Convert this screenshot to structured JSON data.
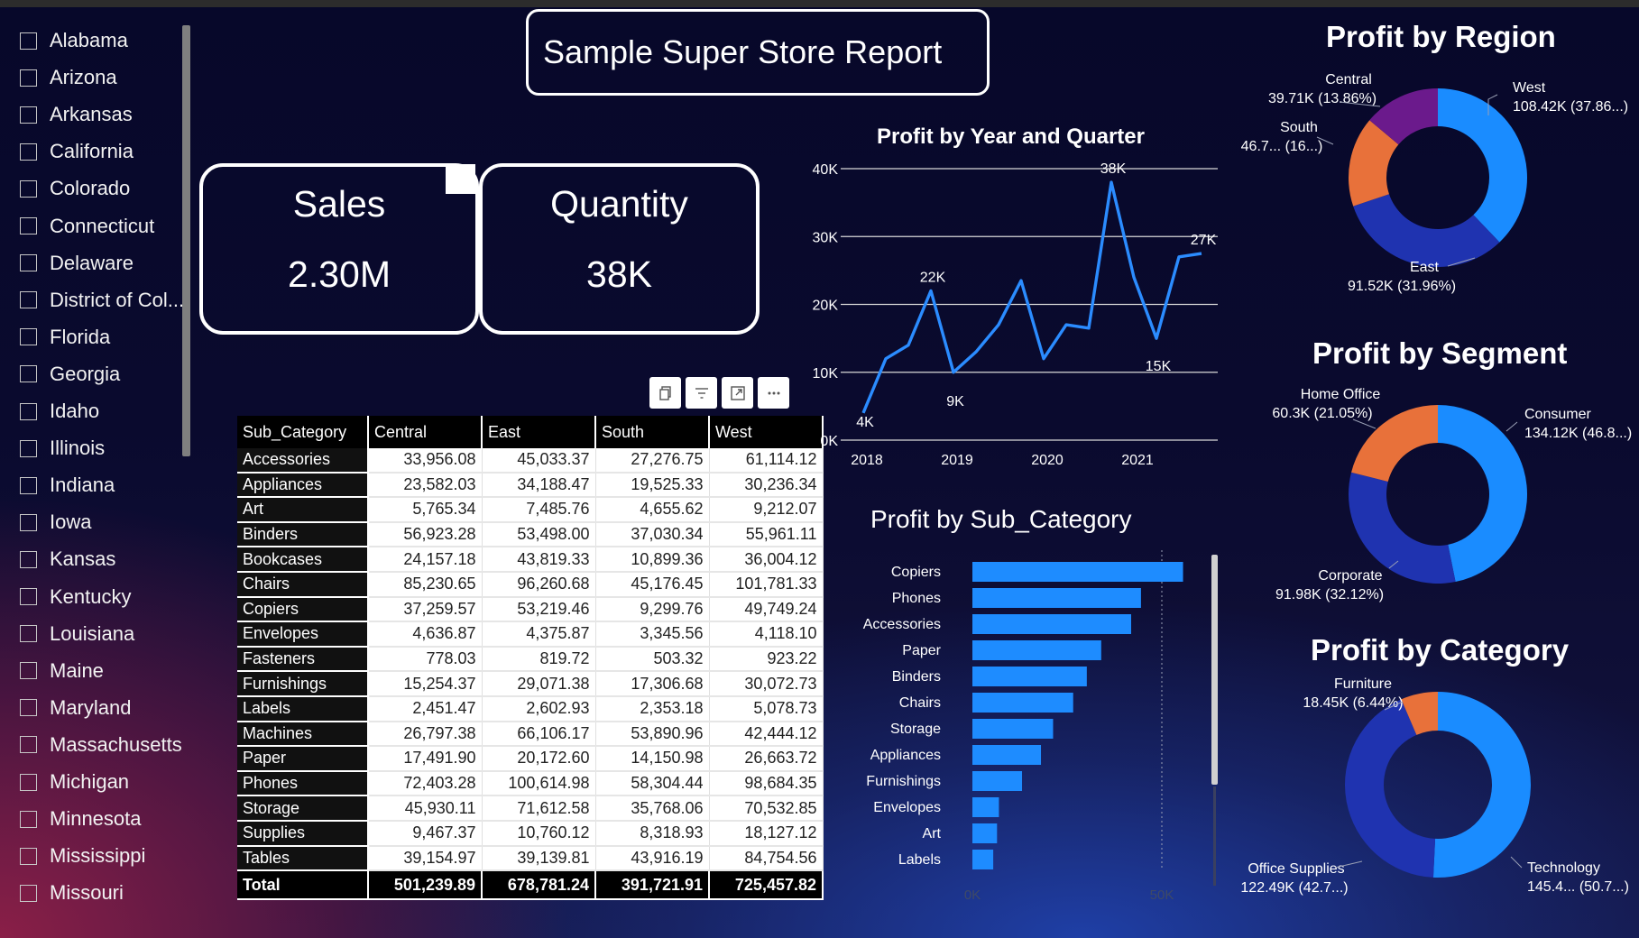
{
  "report_title": "Sample Super Store Report",
  "slicer": {
    "items": [
      "Alabama",
      "Arizona",
      "Arkansas",
      "California",
      "Colorado",
      "Connecticut",
      "Delaware",
      "District of Col...",
      "Florida",
      "Georgia",
      "Idaho",
      "Illinois",
      "Indiana",
      "Iowa",
      "Kansas",
      "Kentucky",
      "Louisiana",
      "Maine",
      "Maryland",
      "Massachusetts",
      "Michigan",
      "Minnesota",
      "Mississippi",
      "Missouri"
    ]
  },
  "cards": {
    "sales": {
      "label": "Sales",
      "value": "2.30M"
    },
    "quantity": {
      "label": "Quantity",
      "value": "38K"
    }
  },
  "visual_header": {
    "icons": [
      "copy-icon",
      "filter-icon",
      "focus-mode-icon",
      "more-options-icon"
    ]
  },
  "table": {
    "headers": [
      "Sub_Category",
      "Central",
      "East",
      "South",
      "West"
    ],
    "rows": [
      [
        "Accessories",
        "33,956.08",
        "45,033.37",
        "27,276.75",
        "61,114.12"
      ],
      [
        "Appliances",
        "23,582.03",
        "34,188.47",
        "19,525.33",
        "30,236.34"
      ],
      [
        "Art",
        "5,765.34",
        "7,485.76",
        "4,655.62",
        "9,212.07"
      ],
      [
        "Binders",
        "56,923.28",
        "53,498.00",
        "37,030.34",
        "55,961.11"
      ],
      [
        "Bookcases",
        "24,157.18",
        "43,819.33",
        "10,899.36",
        "36,004.12"
      ],
      [
        "Chairs",
        "85,230.65",
        "96,260.68",
        "45,176.45",
        "101,781.33"
      ],
      [
        "Copiers",
        "37,259.57",
        "53,219.46",
        "9,299.76",
        "49,749.24"
      ],
      [
        "Envelopes",
        "4,636.87",
        "4,375.87",
        "3,345.56",
        "4,118.10"
      ],
      [
        "Fasteners",
        "778.03",
        "819.72",
        "503.32",
        "923.22"
      ],
      [
        "Furnishings",
        "15,254.37",
        "29,071.38",
        "17,306.68",
        "30,072.73"
      ],
      [
        "Labels",
        "2,451.47",
        "2,602.93",
        "2,353.18",
        "5,078.73"
      ],
      [
        "Machines",
        "26,797.38",
        "66,106.17",
        "53,890.96",
        "42,444.12"
      ],
      [
        "Paper",
        "17,491.90",
        "20,172.60",
        "14,150.98",
        "26,663.72"
      ],
      [
        "Phones",
        "72,403.28",
        "100,614.98",
        "58,304.44",
        "98,684.35"
      ],
      [
        "Storage",
        "45,930.11",
        "71,612.58",
        "35,768.06",
        "70,532.85"
      ],
      [
        "Supplies",
        "9,467.37",
        "10,760.12",
        "8,318.93",
        "18,127.12"
      ],
      [
        "Tables",
        "39,154.97",
        "39,139.81",
        "43,916.19",
        "84,754.56"
      ]
    ],
    "total": [
      "Total",
      "501,239.89",
      "678,781.24",
      "391,721.91",
      "725,457.82"
    ]
  },
  "chart_data": [
    {
      "id": "year_quarter",
      "type": "line",
      "title": "Profit by Year and Quarter",
      "x_ticks": [
        "2018",
        "2019",
        "2020",
        "2021"
      ],
      "y_ticks": [
        "0K",
        "10K",
        "20K",
        "30K",
        "40K"
      ],
      "ylim": [
        0,
        40
      ],
      "values": [
        4,
        12,
        14,
        22,
        10,
        13,
        17,
        23.5,
        12,
        17,
        16.5,
        38,
        24,
        15,
        27,
        27.5
      ],
      "data_labels": [
        {
          "i": 0,
          "text": "4K"
        },
        {
          "i": 3,
          "text": "22K"
        },
        {
          "i": 4,
          "text": "9K"
        },
        {
          "i": 11,
          "text": "38K"
        },
        {
          "i": 13,
          "text": "15K"
        },
        {
          "i": 15,
          "text": "27K"
        }
      ],
      "color": "#2b8cff"
    },
    {
      "id": "sub_category",
      "type": "bar",
      "orientation": "horizontal",
      "title": "Profit by Sub_Category",
      "categories": [
        "Copiers",
        "Phones",
        "Accessories",
        "Paper",
        "Binders",
        "Chairs",
        "Storage",
        "Appliances",
        "Furnishings",
        "Envelopes",
        "Art",
        "Labels"
      ],
      "values": [
        55.6,
        44.5,
        41.9,
        34.0,
        30.2,
        26.6,
        21.3,
        18.1,
        13.1,
        7.0,
        6.5,
        5.5
      ],
      "x_ticks": [
        "0K",
        "50K"
      ],
      "xlim": [
        0,
        50
      ],
      "color": "#1e8cff"
    },
    {
      "id": "region",
      "type": "pie",
      "donut": true,
      "title": "Profit by Region",
      "slices": [
        {
          "name": "West",
          "value": 108.42,
          "label": "108.42K (37.86...)",
          "color": "#1a8cff"
        },
        {
          "name": "East",
          "value": 91.52,
          "label": "91.52K (31.96%)",
          "color": "#1f33b0"
        },
        {
          "name": "South",
          "value": 46.7,
          "label": "46.7... (16...)",
          "color": "#e8713a"
        },
        {
          "name": "Central",
          "value": 39.71,
          "label": "39.71K (13.86%)",
          "color": "#6b1a8c"
        }
      ]
    },
    {
      "id": "segment",
      "type": "pie",
      "donut": true,
      "title": "Profit by Segment",
      "slices": [
        {
          "name": "Consumer",
          "value": 134.12,
          "label": "134.12K (46.8...)",
          "color": "#1a8cff"
        },
        {
          "name": "Corporate",
          "value": 91.98,
          "label": "91.98K (32.12%)",
          "color": "#1f33b0"
        },
        {
          "name": "Home Office",
          "value": 60.3,
          "label": "60.3K (21.05%)",
          "color": "#e8713a"
        }
      ]
    },
    {
      "id": "category",
      "type": "pie",
      "donut": true,
      "title": "Profit by Category",
      "slices": [
        {
          "name": "Technology",
          "value": 145.4,
          "label": "145.4... (50.7...)",
          "color": "#1a8cff"
        },
        {
          "name": "Office Supplies",
          "value": 122.49,
          "label": "122.49K (42.7...)",
          "color": "#1f33b0"
        },
        {
          "name": "Furniture",
          "value": 18.45,
          "label": "18.45K (6.44%)",
          "color": "#e8713a"
        }
      ]
    }
  ]
}
